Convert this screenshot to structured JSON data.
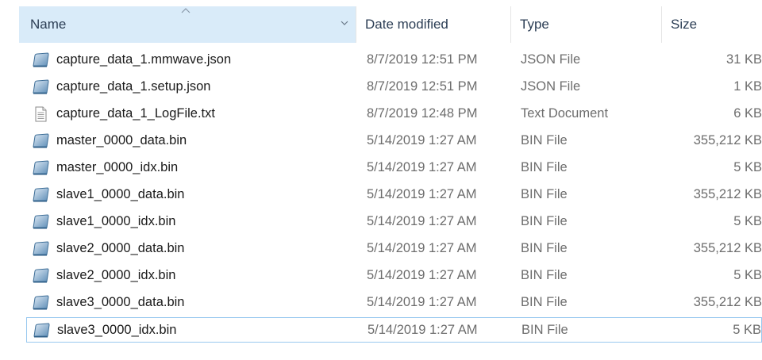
{
  "columns": {
    "name": "Name",
    "date": "Date modified",
    "type": "Type",
    "size": "Size"
  },
  "accent": "#d9ebf9",
  "selected_border": "#99c9ef",
  "files": [
    {
      "name": "capture_data_1.mmwave.json",
      "date": "8/7/2019 12:51 PM",
      "type": "JSON File",
      "size": "31 KB",
      "icon": "generic-file-icon"
    },
    {
      "name": "capture_data_1.setup.json",
      "date": "8/7/2019 12:51 PM",
      "type": "JSON File",
      "size": "1 KB",
      "icon": "generic-file-icon"
    },
    {
      "name": "capture_data_1_LogFile.txt",
      "date": "8/7/2019 12:48 PM",
      "type": "Text Document",
      "size": "6 KB",
      "icon": "text-document-icon"
    },
    {
      "name": "master_0000_data.bin",
      "date": "5/14/2019 1:27 AM",
      "type": "BIN File",
      "size": "355,212 KB",
      "icon": "generic-file-icon"
    },
    {
      "name": "master_0000_idx.bin",
      "date": "5/14/2019 1:27 AM",
      "type": "BIN File",
      "size": "5 KB",
      "icon": "generic-file-icon"
    },
    {
      "name": "slave1_0000_data.bin",
      "date": "5/14/2019 1:27 AM",
      "type": "BIN File",
      "size": "355,212 KB",
      "icon": "generic-file-icon"
    },
    {
      "name": "slave1_0000_idx.bin",
      "date": "5/14/2019 1:27 AM",
      "type": "BIN File",
      "size": "5 KB",
      "icon": "generic-file-icon"
    },
    {
      "name": "slave2_0000_data.bin",
      "date": "5/14/2019 1:27 AM",
      "type": "BIN File",
      "size": "355,212 KB",
      "icon": "generic-file-icon"
    },
    {
      "name": "slave2_0000_idx.bin",
      "date": "5/14/2019 1:27 AM",
      "type": "BIN File",
      "size": "5 KB",
      "icon": "generic-file-icon"
    },
    {
      "name": "slave3_0000_data.bin",
      "date": "5/14/2019 1:27 AM",
      "type": "BIN File",
      "size": "355,212 KB",
      "icon": "generic-file-icon"
    },
    {
      "name": "slave3_0000_idx.bin",
      "date": "5/14/2019 1:27 AM",
      "type": "BIN File",
      "size": "5 KB",
      "icon": "generic-file-icon",
      "selected": true
    }
  ]
}
